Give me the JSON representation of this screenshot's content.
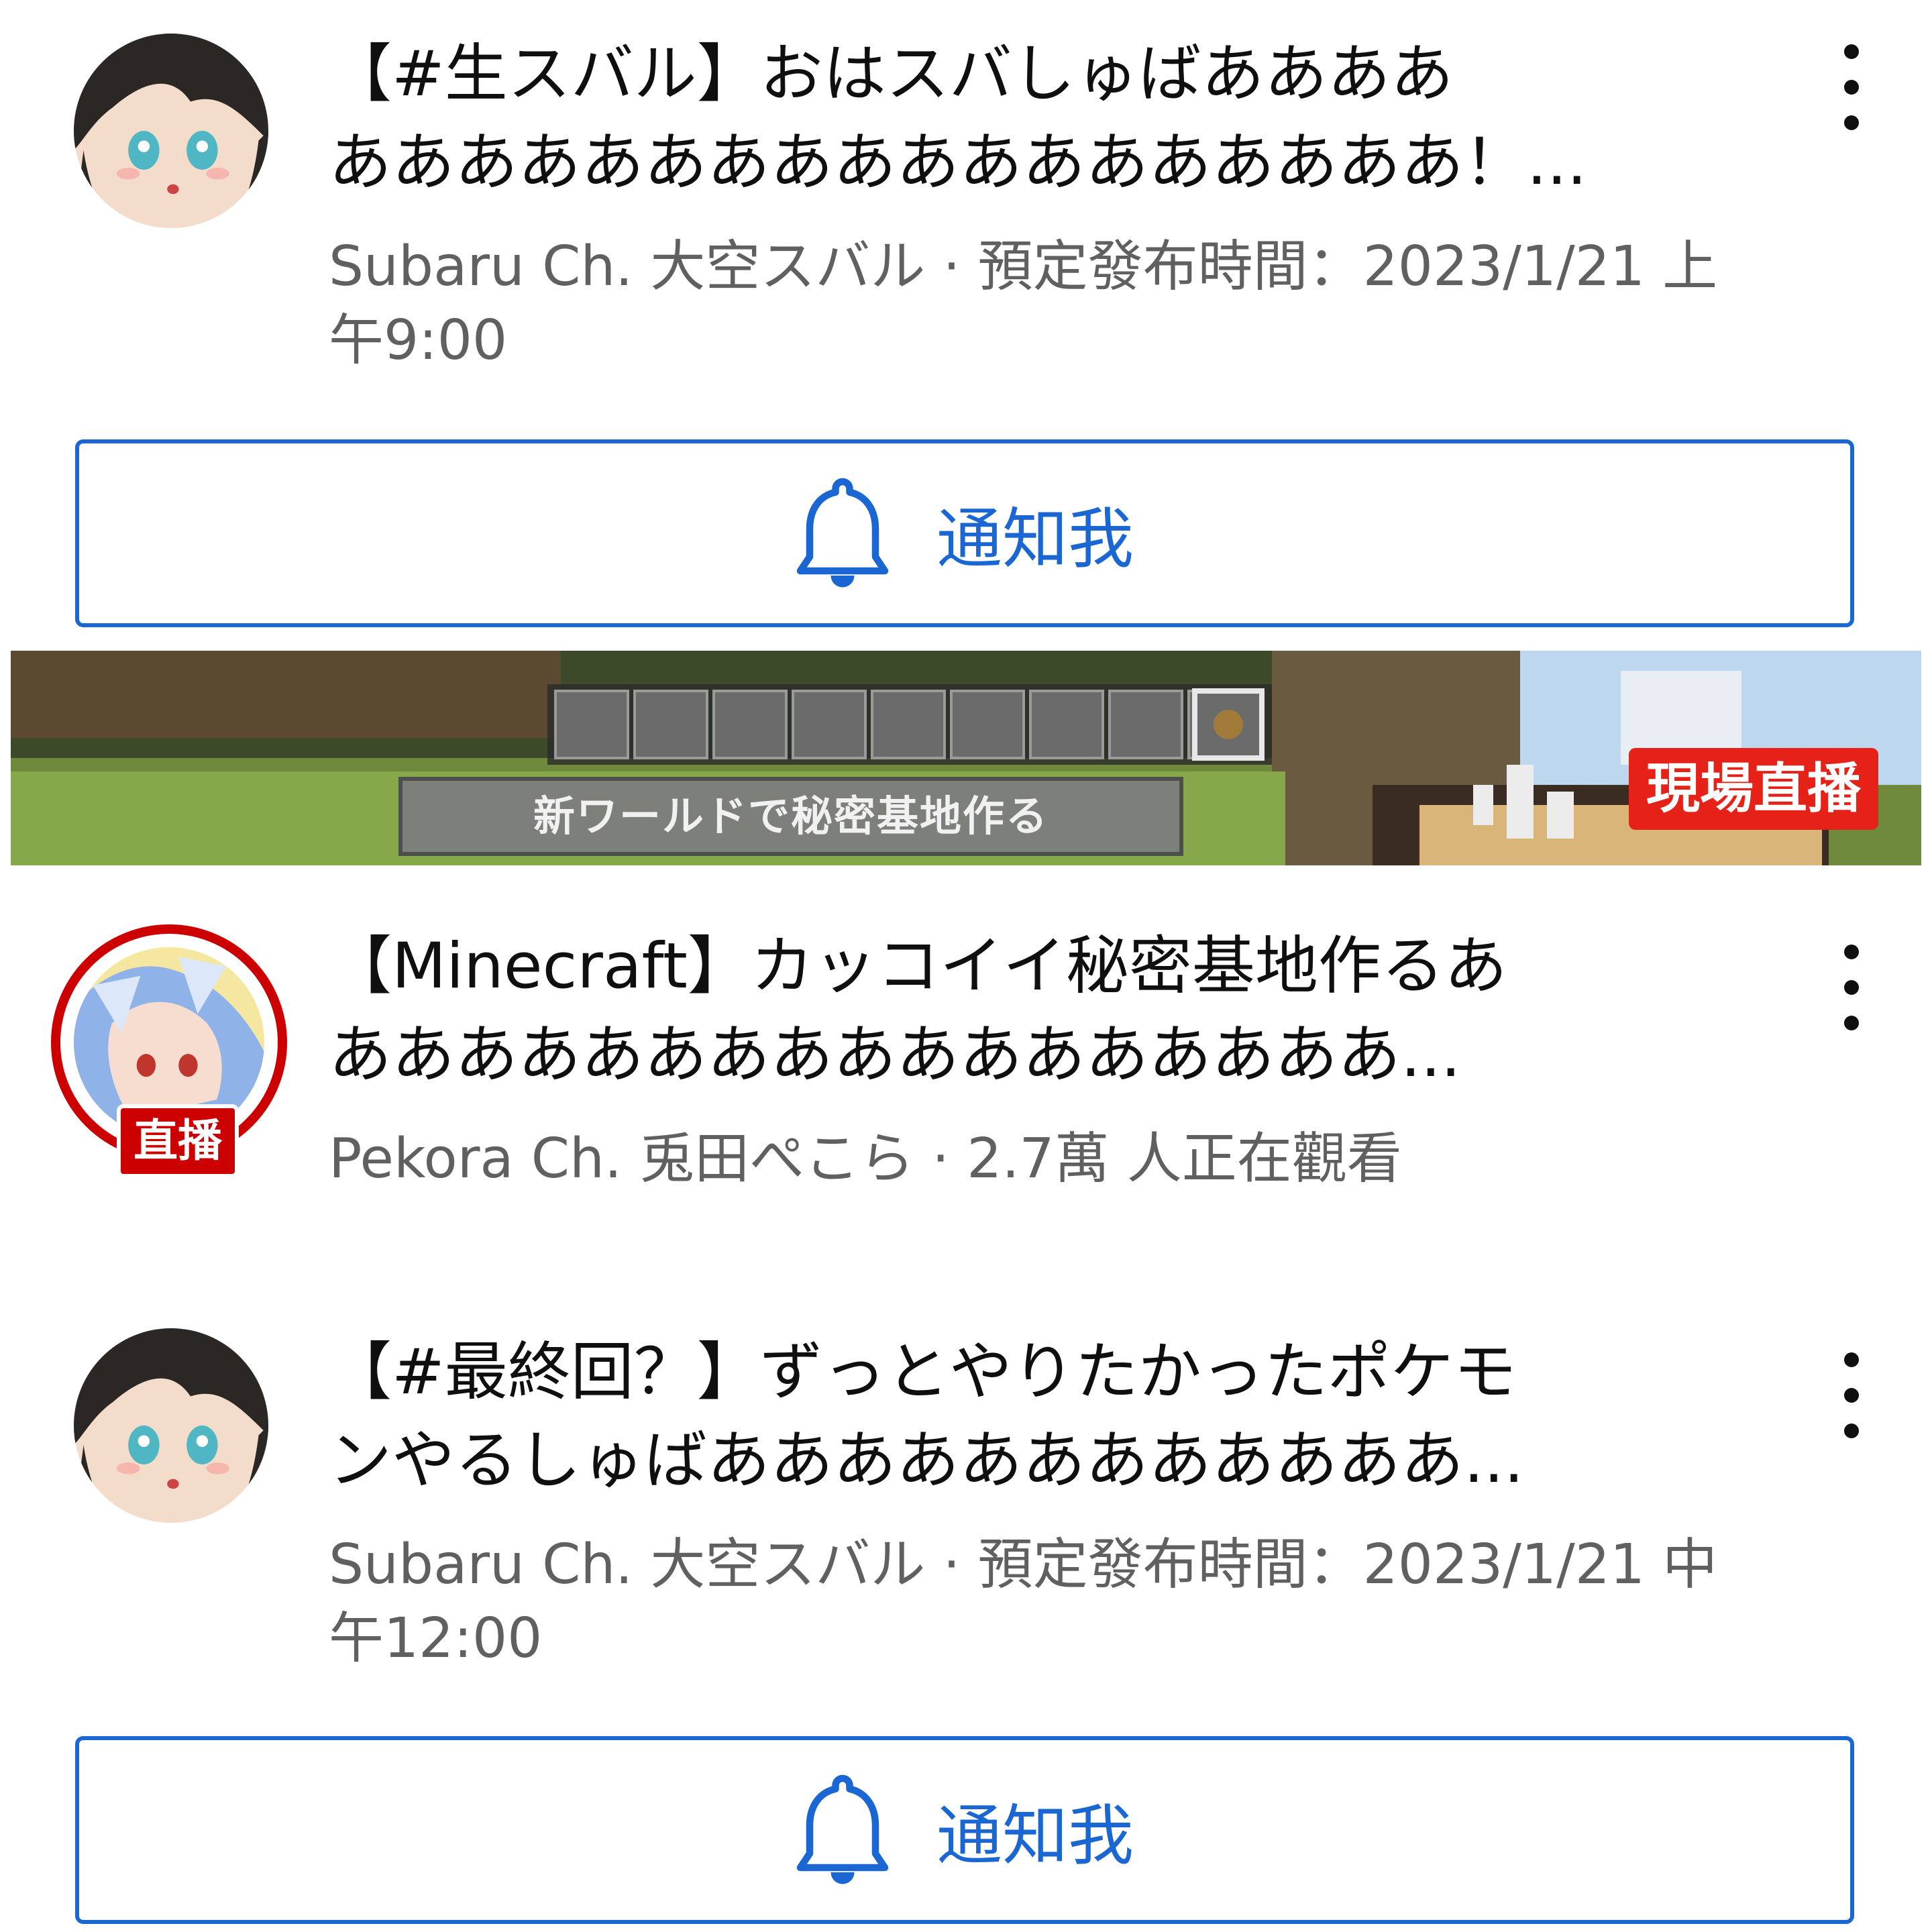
{
  "colors": {
    "accent": "#1a66d2",
    "live": "#cc0000",
    "meta_text": "#606060"
  },
  "items": [
    {
      "title_lines": [
        "【#生スバル】おはスバしゅばああああ",
        "ああああああああああああああああああ！..."
      ],
      "meta_lines": [
        "Subaru Ch. 大空スバル · 預定發布時間：2023/1/21 上",
        "午9:00"
      ],
      "avatar_icon": "subaru-avatar",
      "menu_icon": "more-vert-icon"
    },
    {
      "title_lines": [
        "【Minecraft】カッコイイ秘密基地作るあ",
        "あああああああああああああああああ..."
      ],
      "meta_lines": [
        "Pekora Ch. 兎田ぺこら · 2.7萬 人正在觀看"
      ],
      "avatar_icon": "pekora-avatar",
      "live_small_badge": "直播",
      "menu_icon": "more-vert-icon"
    },
    {
      "title_lines": [
        "【#最終回？】ずっとやりたかったポケモ",
        "ンやるしゅばああああああああああああ..."
      ],
      "meta_lines": [
        "Subaru Ch. 大空スバル · 預定發布時間：2023/1/21 中",
        "午12:00"
      ],
      "avatar_icon": "subaru-avatar",
      "menu_icon": "more-vert-icon"
    }
  ],
  "notify_button": {
    "label": "通知我",
    "icon": "bell-icon"
  },
  "thumbnail": {
    "live_badge": "現場直播",
    "caption": "新ワールドで秘密基地作る"
  }
}
